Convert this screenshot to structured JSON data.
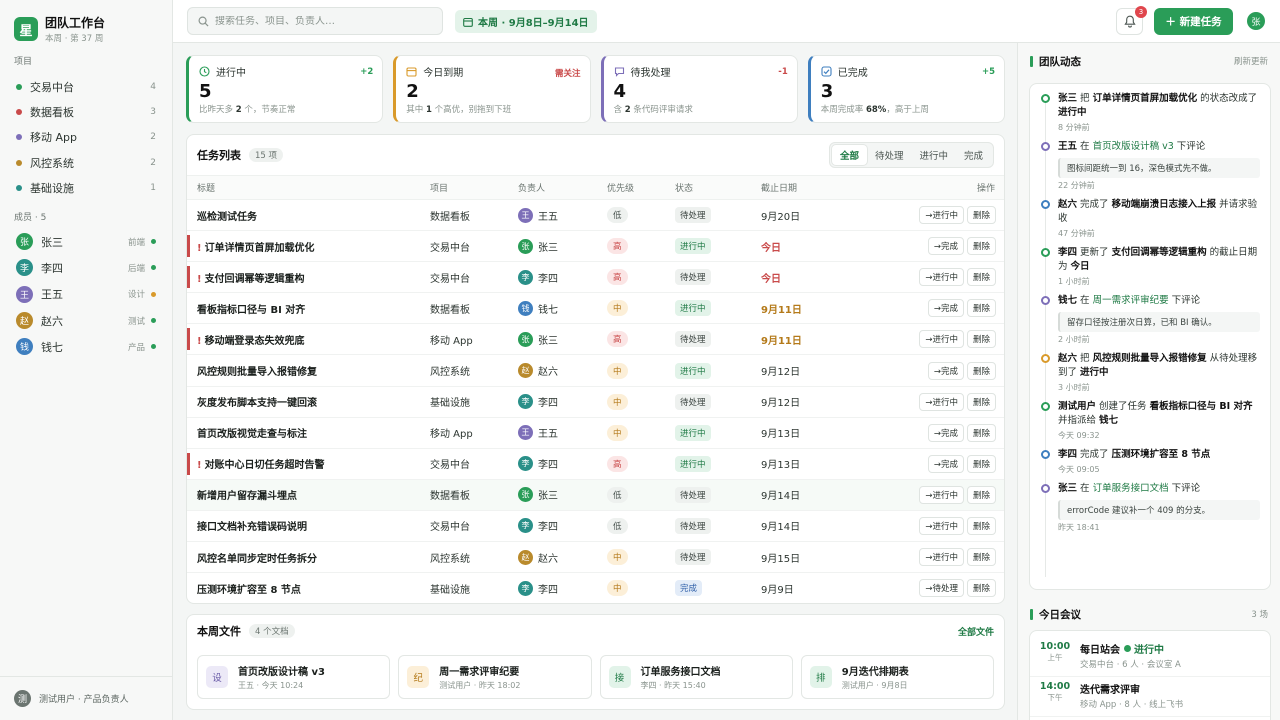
{
  "brand": {
    "logo": "星",
    "title": "团队工作台",
    "subtitle": "本周 · 第 37 周"
  },
  "sidebar": {
    "projects_title": "项目",
    "projects": [
      {
        "name": "交易中台",
        "count": "4",
        "color": "#2a9d58"
      },
      {
        "name": "数据看板",
        "count": "3",
        "color": "#c94a4a"
      },
      {
        "name": "移动 App",
        "count": "2",
        "color": "#7d6fb8"
      },
      {
        "name": "风控系统",
        "count": "2",
        "color": "#b98a2c"
      },
      {
        "name": "基础设施",
        "count": "1",
        "color": "#2a9089"
      }
    ],
    "members_title": "成员 · 5",
    "members": [
      {
        "avatar": "张",
        "name": "张三",
        "role": "前端",
        "avatar_color": "#2a9d58",
        "status_color": "#2a9d58"
      },
      {
        "avatar": "李",
        "name": "李四",
        "role": "后端",
        "avatar_color": "#2a9089",
        "status_color": "#2a9d58"
      },
      {
        "avatar": "王",
        "name": "王五",
        "role": "设计",
        "avatar_color": "#7d6fb8",
        "status_color": "#d99a2b"
      },
      {
        "avatar": "赵",
        "name": "赵六",
        "role": "测试",
        "avatar_color": "#b98a2c",
        "status_color": "#2a9d58"
      },
      {
        "avatar": "钱",
        "name": "钱七",
        "role": "产品",
        "avatar_color": "#3f7fbf",
        "status_color": "#2a9d58"
      }
    ],
    "footer": {
      "avatar": "测",
      "text": "测试用户 · 产品负责人"
    }
  },
  "topbar": {
    "search_placeholder": "搜索任务、项目、负责人…",
    "week_label": "本周 · 9月8日–9月14日",
    "notification_count": "3",
    "new_task_label": "＋ 新建任务",
    "user_avatar": "张",
    "search_icon": "search-icon",
    "calendar_icon": "calendar-icon",
    "bell_icon": "bell-icon"
  },
  "stats": [
    {
      "title": "进行中",
      "delta": "+2",
      "value": "5",
      "desc_pre": "比昨天多 ",
      "desc_em": "2",
      "desc_post": " 个，节奏正常",
      "color": "#2a9d58",
      "delta_color": "#2a9d58",
      "icon": "clock-icon"
    },
    {
      "title": "今日到期",
      "delta": "需关注",
      "value": "2",
      "desc_pre": "其中 ",
      "desc_em": "1",
      "desc_post": " 个高优，别拖到下班",
      "color": "#d99a2b",
      "delta_color": "#c94a4a",
      "icon": "calendar-icon"
    },
    {
      "title": "待我处理",
      "delta": "-1",
      "value": "4",
      "desc_pre": "含 ",
      "desc_em": "2",
      "desc_post": " 条代码评审请求",
      "color": "#7d6fb8",
      "delta_color": "#c94a4a",
      "icon": "chat-icon"
    },
    {
      "title": "已完成",
      "delta": "+5",
      "value": "3",
      "desc_pre": "本周完成率 ",
      "desc_em": "68%",
      "desc_post": "，高于上周",
      "color": "#3f7fbf",
      "delta_color": "#2a9d58",
      "icon": "check-icon"
    }
  ],
  "tasks": {
    "title": "任务列表",
    "count": "15 项",
    "filters": [
      "全部",
      "待处理",
      "进行中",
      "完成"
    ],
    "active_filter": "全部",
    "columns": [
      "标题",
      "项目",
      "负责人",
      "优先级",
      "状态",
      "截止日期",
      "操作"
    ],
    "rows": [
      {
        "title": "巡检测试任务",
        "urgent": false,
        "project": "数据看板",
        "owner": "王五",
        "owner_avatar": "王",
        "owner_color": "#7d6fb8",
        "priority": "低",
        "prio_class": "low",
        "status": "待处理",
        "status_class": "st-pending",
        "due": "9月20日",
        "due_class": "",
        "action": "→进行中",
        "delete": "删除"
      },
      {
        "title": "订单详情页首屏加载优化",
        "urgent": true,
        "project": "交易中台",
        "owner": "张三",
        "owner_avatar": "张",
        "owner_color": "#2a9d58",
        "priority": "高",
        "prio_class": "high",
        "status": "进行中",
        "status_class": "st-progress",
        "due": "今日",
        "due_class": "due-red",
        "action": "→完成",
        "delete": "删除"
      },
      {
        "title": "支付回调幂等逻辑重构",
        "urgent": true,
        "project": "交易中台",
        "owner": "李四",
        "owner_avatar": "李",
        "owner_color": "#2a9089",
        "priority": "高",
        "prio_class": "high",
        "status": "待处理",
        "status_class": "st-pending",
        "due": "今日",
        "due_class": "due-red",
        "action": "→进行中",
        "delete": "删除"
      },
      {
        "title": "看板指标口径与 BI 对齐",
        "urgent": false,
        "project": "数据看板",
        "owner": "钱七",
        "owner_avatar": "钱",
        "owner_color": "#3f7fbf",
        "priority": "中",
        "prio_class": "mid",
        "status": "进行中",
        "status_class": "st-progress",
        "due": "9月11日",
        "due_class": "due-amber",
        "action": "→完成",
        "delete": "删除"
      },
      {
        "title": "移动端登录态失效兜底",
        "urgent": true,
        "project": "移动 App",
        "owner": "张三",
        "owner_avatar": "张",
        "owner_color": "#2a9d58",
        "priority": "高",
        "prio_class": "high",
        "status": "待处理",
        "status_class": "st-pending",
        "due": "9月11日",
        "due_class": "due-amber",
        "action": "→进行中",
        "delete": "删除"
      },
      {
        "title": "风控规则批量导入报错修复",
        "urgent": false,
        "project": "风控系统",
        "owner": "赵六",
        "owner_avatar": "赵",
        "owner_color": "#b98a2c",
        "priority": "中",
        "prio_class": "mid",
        "status": "进行中",
        "status_class": "st-progress",
        "due": "9月12日",
        "due_class": "",
        "action": "→完成",
        "delete": "删除"
      },
      {
        "title": "灰度发布脚本支持一键回滚",
        "urgent": false,
        "project": "基础设施",
        "owner": "李四",
        "owner_avatar": "李",
        "owner_color": "#2a9089",
        "priority": "中",
        "prio_class": "mid",
        "status": "待处理",
        "status_class": "st-pending",
        "due": "9月12日",
        "due_class": "",
        "action": "→进行中",
        "delete": "删除"
      },
      {
        "title": "首页改版视觉走查与标注",
        "urgent": false,
        "project": "移动 App",
        "owner": "王五",
        "owner_avatar": "王",
        "owner_color": "#7d6fb8",
        "priority": "中",
        "prio_class": "mid",
        "status": "进行中",
        "status_class": "st-progress",
        "due": "9月13日",
        "due_class": "",
        "action": "→完成",
        "delete": "删除"
      },
      {
        "title": "对账中心日切任务超时告警",
        "urgent": true,
        "project": "交易中台",
        "owner": "李四",
        "owner_avatar": "李",
        "owner_color": "#2a9089",
        "priority": "高",
        "prio_class": "high",
        "status": "进行中",
        "status_class": "st-progress",
        "due": "9月13日",
        "due_class": "",
        "action": "→完成",
        "delete": "删除"
      },
      {
        "title": "新增用户留存漏斗埋点",
        "urgent": false,
        "project": "数据看板",
        "owner": "张三",
        "owner_avatar": "张",
        "owner_color": "#2a9d58",
        "priority": "低",
        "prio_class": "low",
        "status": "待处理",
        "status_class": "st-pending",
        "due": "9月14日",
        "due_class": "",
        "action": "→进行中",
        "delete": "删除",
        "highlight": true
      },
      {
        "title": "接口文档补充错误码说明",
        "urgent": false,
        "project": "交易中台",
        "owner": "李四",
        "owner_avatar": "李",
        "owner_color": "#2a9089",
        "priority": "低",
        "prio_class": "low",
        "status": "待处理",
        "status_class": "st-pending",
        "due": "9月14日",
        "due_class": "",
        "action": "→进行中",
        "delete": "删除"
      },
      {
        "title": "风控名单同步定时任务拆分",
        "urgent": false,
        "project": "风控系统",
        "owner": "赵六",
        "owner_avatar": "赵",
        "owner_color": "#b98a2c",
        "priority": "中",
        "prio_class": "mid",
        "status": "待处理",
        "status_class": "st-pending",
        "due": "9月15日",
        "due_class": "",
        "action": "→进行中",
        "delete": "删除"
      },
      {
        "title": "压测环境扩容至 8 节点",
        "urgent": false,
        "project": "基础设施",
        "owner": "李四",
        "owner_avatar": "李",
        "owner_color": "#2a9089",
        "priority": "中",
        "prio_class": "mid",
        "status": "完成",
        "status_class": "st-done",
        "due": "9月9日",
        "due_class": "",
        "action": "→待处理",
        "delete": "删除"
      }
    ]
  },
  "files": {
    "title": "本周文件",
    "count": "4 个文档",
    "all_label": "全部文件",
    "items": [
      {
        "icon": "设",
        "name": "首页改版设计稿 v3",
        "meta": "王五 · 今天 10:24",
        "icon_bg": "#ece9f7",
        "icon_fg": "#6a5ca8"
      },
      {
        "icon": "纪",
        "name": "周一需求评审纪要",
        "meta": "测试用户 · 昨天 18:02",
        "icon_bg": "#fcefd8",
        "icon_fg": "#b47a1a"
      },
      {
        "icon": "接",
        "name": "订单服务接口文档",
        "meta": "李四 · 昨天 15:40",
        "icon_bg": "#e2f3e9",
        "icon_fg": "#1f7a45"
      },
      {
        "icon": "排",
        "name": "9月迭代排期表",
        "meta": "测试用户 · 9月8日",
        "icon_bg": "#e2f3e9",
        "icon_fg": "#1f7a45"
      }
    ]
  },
  "activity": {
    "title": "团队动态",
    "refresh_label": "刷新更新",
    "events": [
      {
        "dot": "#2a9d58",
        "parts": [
          [
            "b",
            "张三"
          ],
          [
            "t",
            " 把 "
          ],
          [
            "b",
            "订单详情页首屏加载优化"
          ],
          [
            "t",
            " 的状态改成了 "
          ],
          [
            "b",
            "进行中"
          ]
        ],
        "quote": "",
        "time": "8 分钟前"
      },
      {
        "dot": "#7d6fb8",
        "parts": [
          [
            "b",
            "王五"
          ],
          [
            "t",
            " 在 "
          ],
          [
            "l",
            "首页改版设计稿 v3"
          ],
          [
            "t",
            " 下评论"
          ]
        ],
        "quote": "图标间距统一到 16，深色模式先不做。",
        "time": "22 分钟前"
      },
      {
        "dot": "#3f7fbf",
        "parts": [
          [
            "b",
            "赵六"
          ],
          [
            "t",
            " 完成了 "
          ],
          [
            "b",
            "移动端崩溃日志接入上报"
          ],
          [
            "t",
            " 并请求验收"
          ]
        ],
        "quote": "",
        "time": "47 分钟前"
      },
      {
        "dot": "#2a9d58",
        "parts": [
          [
            "b",
            "李四"
          ],
          [
            "t",
            " 更新了 "
          ],
          [
            "b",
            "支付回调幂等逻辑重构"
          ],
          [
            "t",
            " 的截止日期为 "
          ],
          [
            "b",
            "今日"
          ]
        ],
        "quote": "",
        "time": "1 小时前"
      },
      {
        "dot": "#7d6fb8",
        "parts": [
          [
            "b",
            "钱七"
          ],
          [
            "t",
            " 在 "
          ],
          [
            "l",
            "周一需求评审纪要"
          ],
          [
            "t",
            " 下评论"
          ]
        ],
        "quote": "留存口径按注册次日算，已和 BI 确认。",
        "time": "2 小时前"
      },
      {
        "dot": "#d99a2b",
        "parts": [
          [
            "b",
            "赵六"
          ],
          [
            "t",
            " 把 "
          ],
          [
            "b",
            "风控规则批量导入报错修复"
          ],
          [
            "t",
            " 从待处理移到了 "
          ],
          [
            "b",
            "进行中"
          ]
        ],
        "quote": "",
        "time": "3 小时前"
      },
      {
        "dot": "#2a9d58",
        "parts": [
          [
            "b",
            "测试用户"
          ],
          [
            "t",
            " 创建了任务 "
          ],
          [
            "b",
            "看板指标口径与 BI 对齐"
          ],
          [
            "t",
            " 并指派给 "
          ],
          [
            "b",
            "钱七"
          ]
        ],
        "quote": "",
        "time": "今天 09:32"
      },
      {
        "dot": "#3f7fbf",
        "parts": [
          [
            "b",
            "李四"
          ],
          [
            "t",
            " 完成了 "
          ],
          [
            "b",
            "压测环境扩容至 8 节点"
          ]
        ],
        "quote": "",
        "time": "今天 09:05"
      },
      {
        "dot": "#7d6fb8",
        "parts": [
          [
            "b",
            "张三"
          ],
          [
            "t",
            " 在 "
          ],
          [
            "l",
            "订单服务接口文档"
          ],
          [
            "t",
            " 下评论"
          ]
        ],
        "quote": "errorCode 建议补一个 409 的分支。",
        "time": "昨天 18:41"
      }
    ]
  },
  "meetings": {
    "title": "今日会议",
    "count": "3 场",
    "items": [
      {
        "hour": "10:00",
        "ampm": "上午",
        "title": "每日站会",
        "live": "进行中",
        "meta": "交易中台 · 6 人 · 会议室 A"
      },
      {
        "hour": "14:00",
        "ampm": "下午",
        "title": "迭代需求评审",
        "live": "",
        "meta": "移动 App · 8 人 · 线上飞书"
      }
    ]
  }
}
